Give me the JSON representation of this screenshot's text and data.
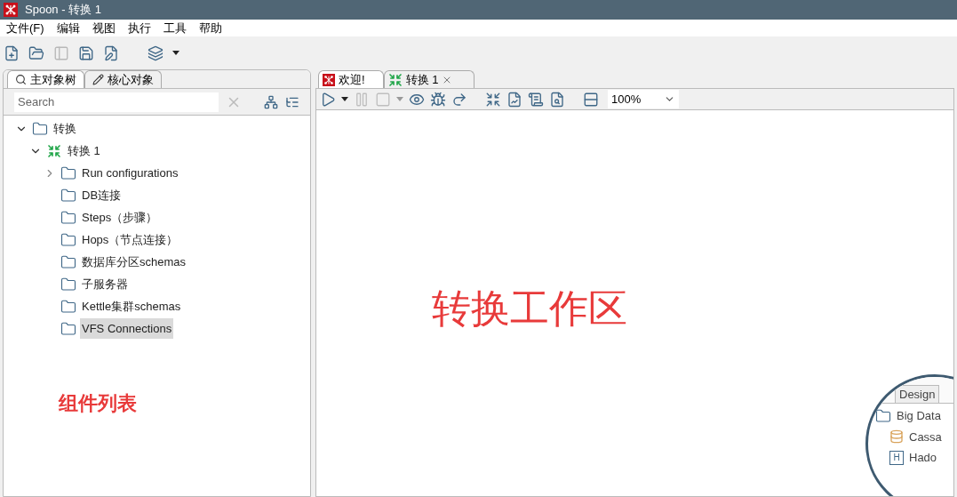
{
  "window": {
    "title": "Spoon - 转换 1"
  },
  "menu": [
    "文件(F)",
    "编辑",
    "视图",
    "执行",
    "工具",
    "帮助"
  ],
  "left_tabs": [
    {
      "label": "主对象树",
      "kind": "tree",
      "selected": true
    },
    {
      "label": "核心对象",
      "kind": "pencil",
      "selected": false
    }
  ],
  "search": {
    "placeholder": "Search"
  },
  "tree": [
    {
      "label": "转换",
      "kind": "folder",
      "expanded": true,
      "selected": false,
      "children": [
        {
          "label": "转换 1",
          "kind": "trans",
          "expanded": true,
          "selected": false,
          "children": [
            {
              "label": "Run configurations",
              "kind": "folder",
              "expanded": false,
              "selected": false
            },
            {
              "label": "DB连接",
              "kind": "folder",
              "selected": false
            },
            {
              "label": "Steps（步骤）",
              "kind": "folder",
              "selected": false
            },
            {
              "label": "Hops（节点连接）",
              "kind": "folder",
              "selected": false
            },
            {
              "label": "数据库分区schemas",
              "kind": "folder",
              "selected": false
            },
            {
              "label": "子服务器",
              "kind": "folder",
              "selected": false
            },
            {
              "label": "Kettle集群schemas",
              "kind": "folder",
              "selected": false
            },
            {
              "label": "VFS Connections",
              "kind": "folder",
              "selected": true
            }
          ]
        }
      ]
    }
  ],
  "tree_annotation": "组件列表",
  "editor_tabs": [
    {
      "label": "欢迎!",
      "kind": "welcome",
      "selected": false
    },
    {
      "label": "转换 1",
      "kind": "trans",
      "selected": true
    }
  ],
  "zoom": "100%",
  "canvas_annotation": "转换工作区",
  "magnifier": {
    "tab": "Design",
    "items": [
      {
        "label": "Big Data",
        "kind": "folder"
      },
      {
        "label": "Cassa",
        "kind": "db"
      },
      {
        "label": "Hado",
        "kind": "badge",
        "icon_text": "H"
      }
    ]
  }
}
